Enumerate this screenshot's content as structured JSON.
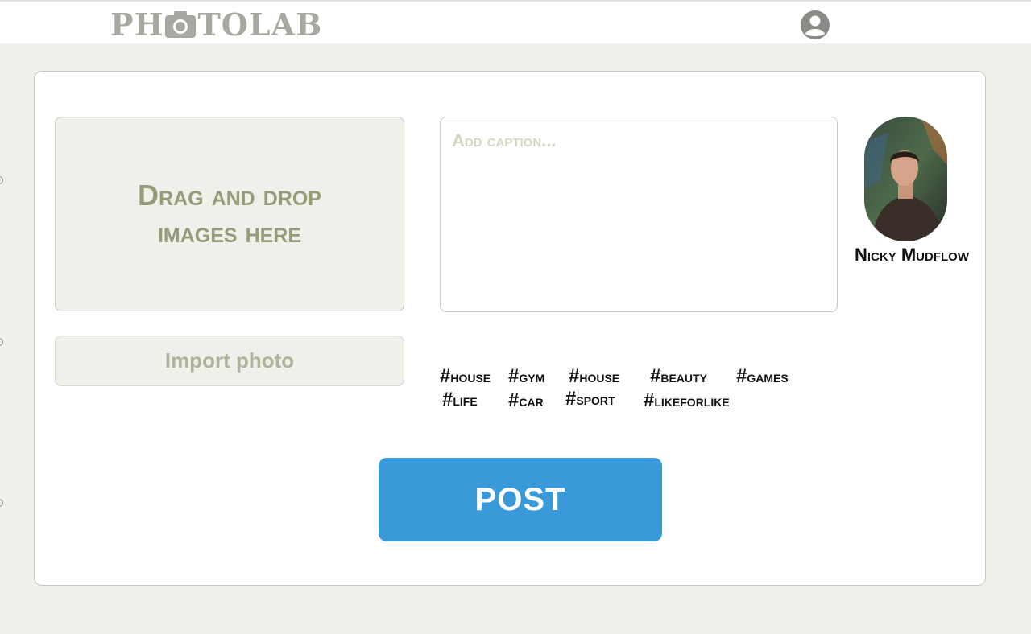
{
  "header": {
    "logo_left": "PH",
    "logo_right": "TOLAB",
    "logo_icon": "camera-icon",
    "profile_icon": "account-circle-icon"
  },
  "upload": {
    "dropzone_text": "Drag and drop images here",
    "import_label": "Import photo"
  },
  "caption": {
    "placeholder": "Add caption...",
    "value": ""
  },
  "user": {
    "name": "Nicky Mudflow"
  },
  "hashtags": {
    "hash_symbol": "#",
    "row1": [
      "house",
      "gym",
      "house",
      "beauty",
      "games"
    ],
    "row2": [
      "life",
      "car",
      "sport",
      "likeforlike"
    ]
  },
  "actions": {
    "post_label": "POST"
  },
  "colors": {
    "accent": "#3a99d9",
    "background": "#f0f0ea",
    "muted_text": "#969c7a"
  }
}
